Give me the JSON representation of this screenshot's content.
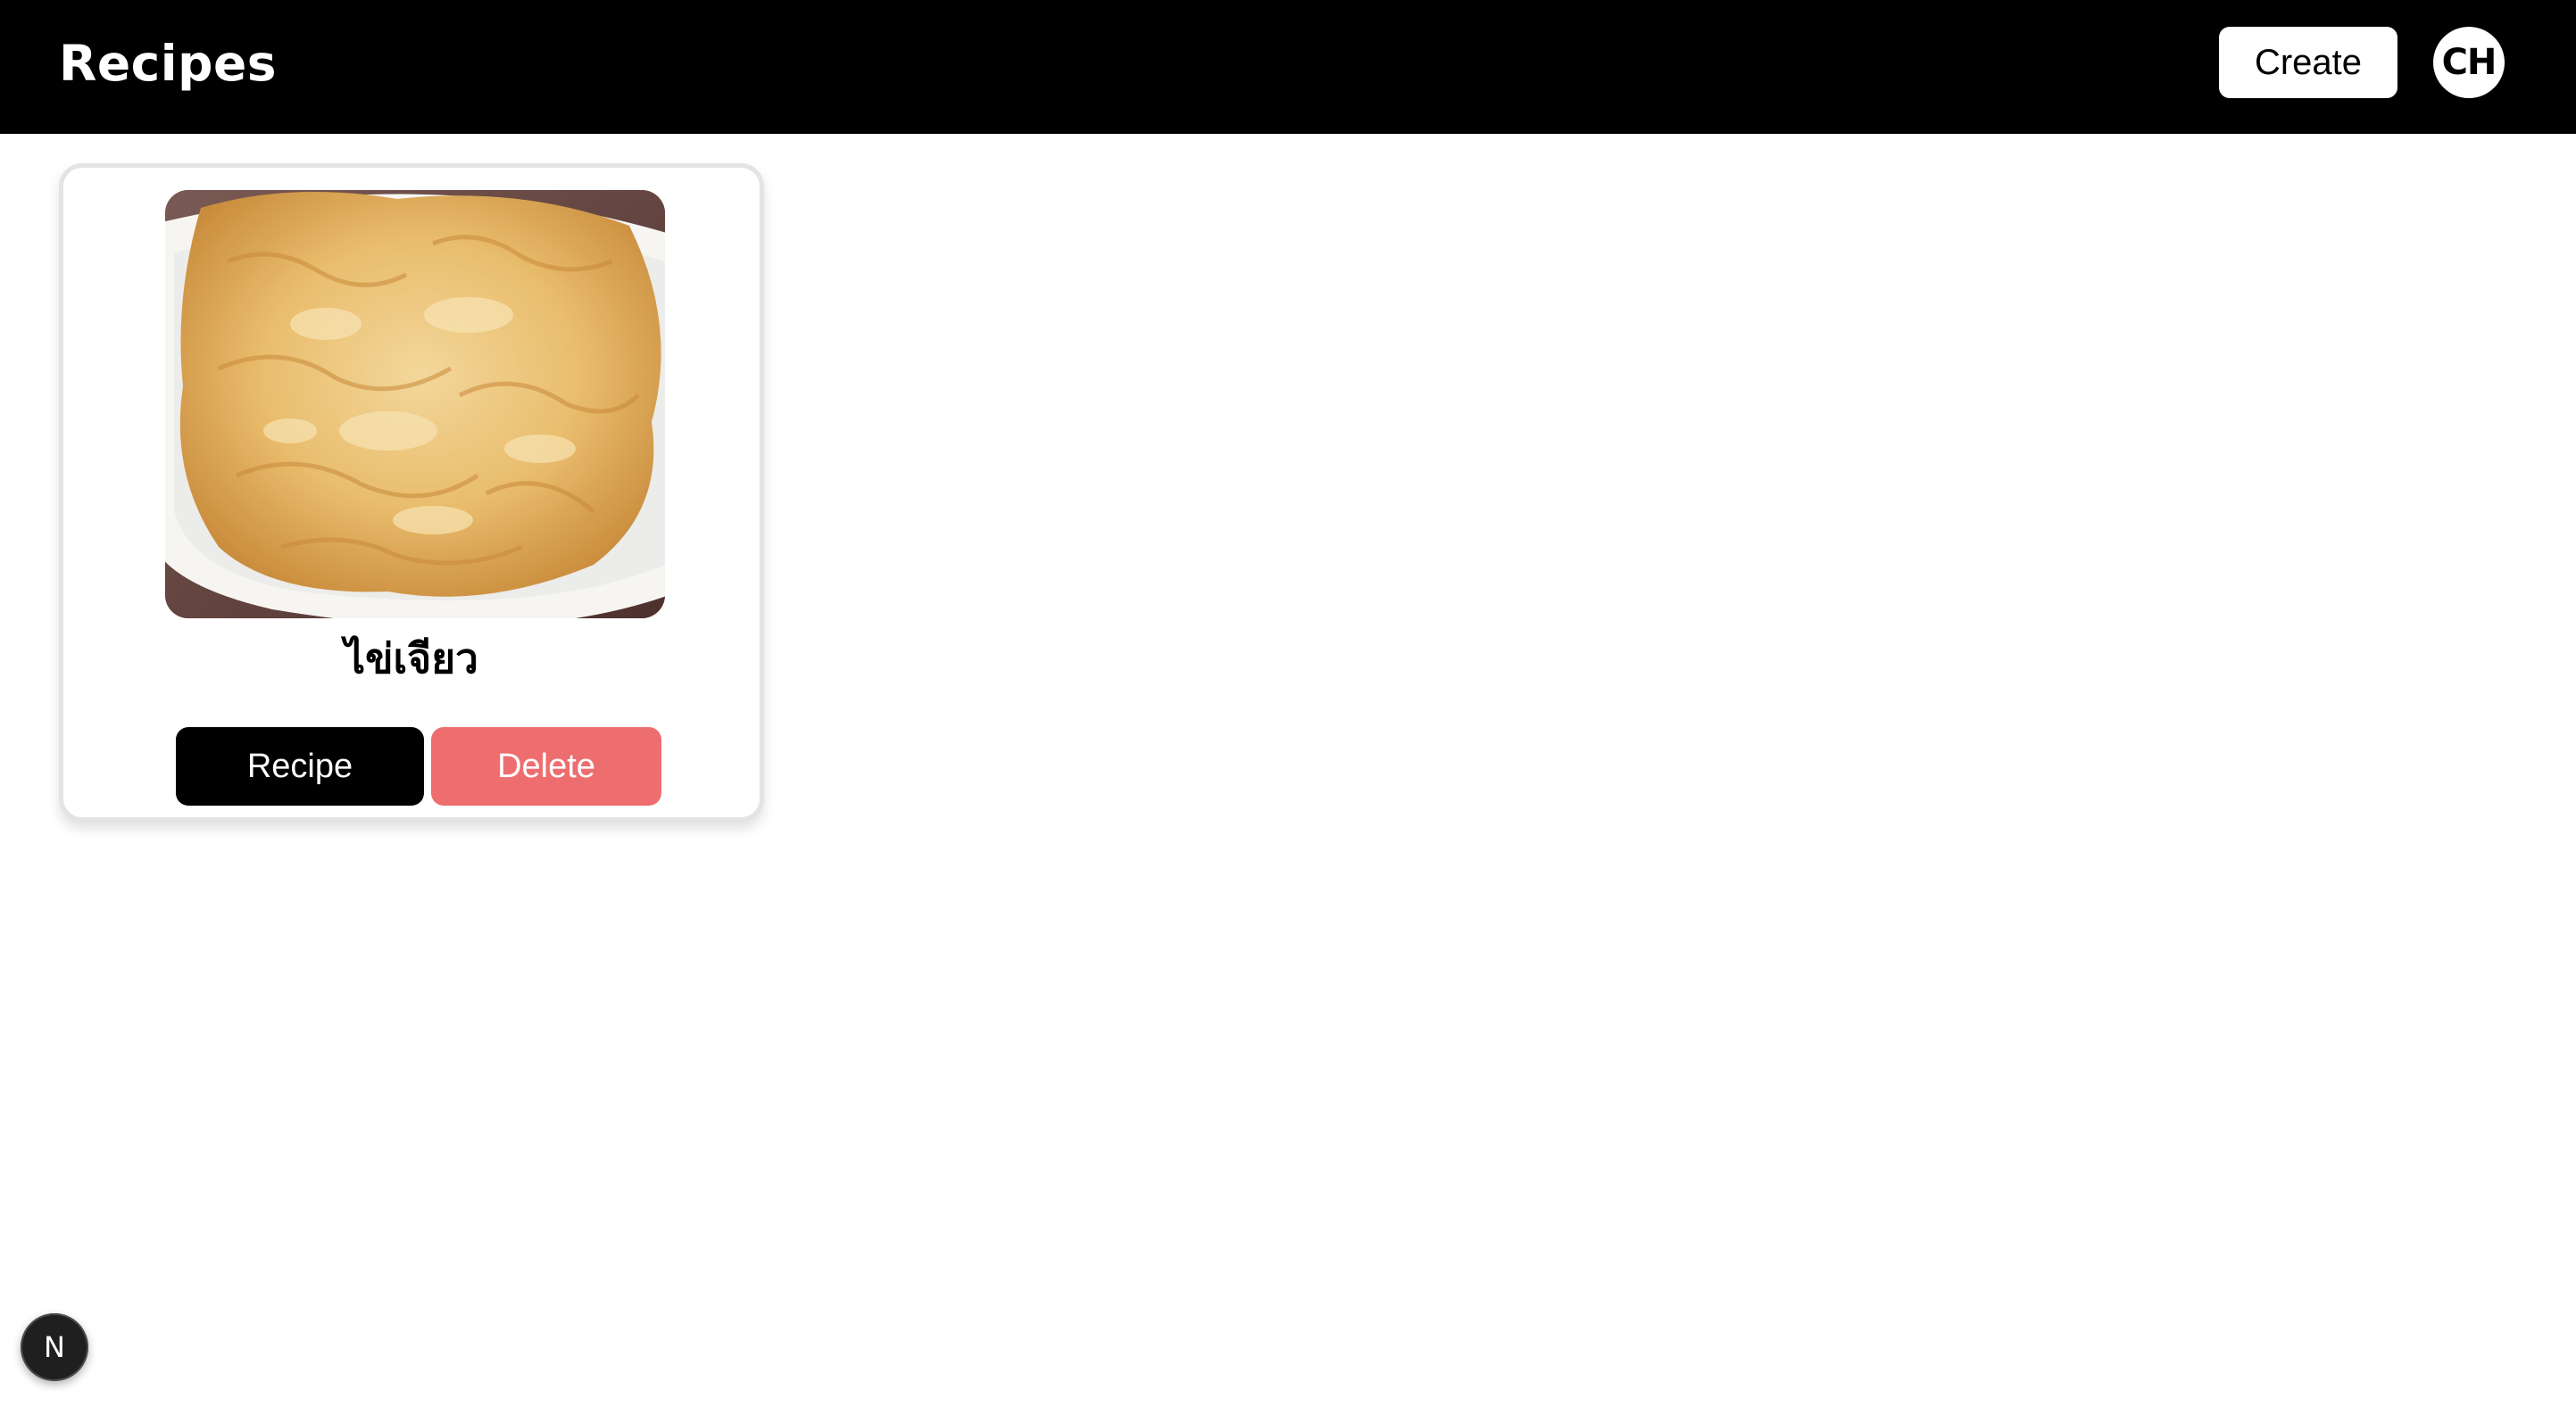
{
  "header": {
    "title": "Recipes",
    "create_label": "Create",
    "avatar_initials": "CH"
  },
  "recipes": [
    {
      "name": "ไข่เจียว",
      "image_alt": "Thai omelette on a white plate",
      "recipe_label": "Recipe",
      "delete_label": "Delete"
    }
  ],
  "dev_badge": {
    "letter": "N"
  },
  "colors": {
    "navbar_bg": "#000000",
    "delete_bg": "#ee6e70",
    "recipe_bg": "#000000",
    "card_border": "#e4e4e4"
  }
}
